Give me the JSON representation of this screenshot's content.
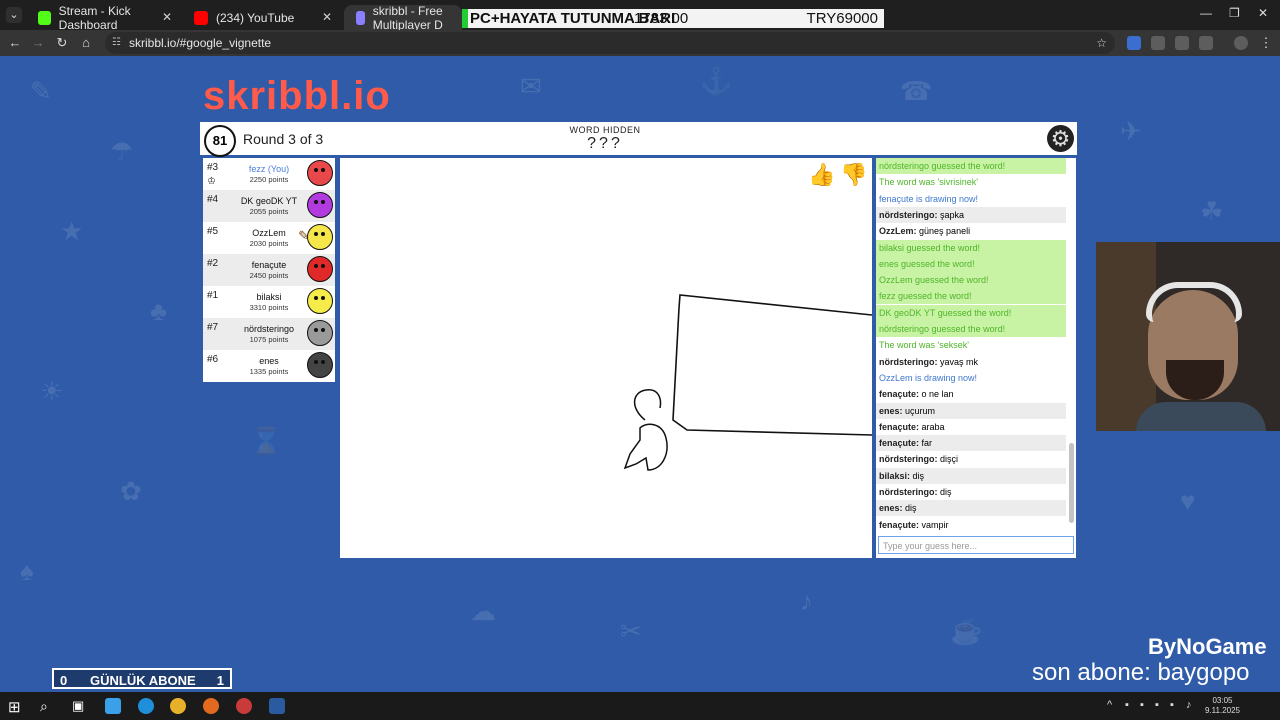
{
  "browser": {
    "tabs": [
      {
        "title": "Stream - Kick Dashboard",
        "icon": "kick-icon",
        "color": "#53fc18"
      },
      {
        "title": "(234) YouTube",
        "icon": "youtube-icon",
        "color": "#ff0000"
      },
      {
        "title": "skribbl - Free Multiplayer D",
        "icon": "skribbl-icon",
        "color": "#8a7fff"
      }
    ],
    "url": "skribbl.io/#google_vignette"
  },
  "ticker": {
    "left": "PC+HAYATA TUTUNMA BARI",
    "middle": "1783.00",
    "right": "TRY69000"
  },
  "game": {
    "logo_text": "skribbl.io",
    "timer": "81",
    "round": "Round 3 of 3",
    "word_status": "WORD HIDDEN",
    "word_mask": "???",
    "hint_tooltip": "vampir"
  },
  "players": [
    {
      "rank": "#3",
      "name": "fezz (You)",
      "points": "2250 points",
      "avatar_color": "#e8484a",
      "you": true,
      "crown": true
    },
    {
      "rank": "#4",
      "name": "DK geoDK YT",
      "points": "2055 points",
      "avatar_color": "#b23be0"
    },
    {
      "rank": "#5",
      "name": "OzzLem",
      "points": "2030 points",
      "avatar_color": "#f5e64a",
      "drawing": true
    },
    {
      "rank": "#2",
      "name": "fenaçute",
      "points": "2450 points",
      "avatar_color": "#e02929"
    },
    {
      "rank": "#1",
      "name": "bilaksi",
      "points": "3310 points",
      "avatar_color": "#f5ec4a"
    },
    {
      "rank": "#7",
      "name": "nördsteringo",
      "points": "1075 points",
      "avatar_color": "#9a9a9a"
    },
    {
      "rank": "#6",
      "name": "enes",
      "points": "1335 points",
      "avatar_color": "#444444"
    }
  ],
  "chat": [
    {
      "type": "ok",
      "text": "nördsteringo guessed the word!"
    },
    {
      "type": "sys",
      "text": "The word was 'sivrisinek'"
    },
    {
      "type": "draw",
      "text": "fenaçute is drawing now!"
    },
    {
      "type": "msg",
      "user": "nördsteringo:",
      "text": "şapka"
    },
    {
      "type": "msg",
      "user": "OzzLem:",
      "text": "güneş paneli"
    },
    {
      "type": "ok",
      "text": "bilaksi guessed the word!"
    },
    {
      "type": "ok",
      "text": "enes guessed the word!"
    },
    {
      "type": "ok",
      "text": "OzzLem guessed the word!"
    },
    {
      "type": "ok",
      "text": "fezz guessed the word!"
    },
    {
      "type": "ok",
      "text": "DK geoDK YT guessed the word!"
    },
    {
      "type": "ok",
      "text": "nördsteringo guessed the word!"
    },
    {
      "type": "sys",
      "text": "The word was 'seksek'"
    },
    {
      "type": "msg",
      "user": "nördsteringo:",
      "text": "yavaş mk"
    },
    {
      "type": "draw",
      "text": "OzzLem is drawing now!"
    },
    {
      "type": "msg",
      "user": "fenaçute:",
      "text": "o ne lan"
    },
    {
      "type": "msg",
      "user": "enes:",
      "text": "uçurum"
    },
    {
      "type": "msg",
      "user": "fenaçute:",
      "text": "araba"
    },
    {
      "type": "msg",
      "user": "fenaçute:",
      "text": "far"
    },
    {
      "type": "msg",
      "user": "nördsteringo:",
      "text": "dişçi"
    },
    {
      "type": "msg",
      "user": "bilaksi:",
      "text": "diş"
    },
    {
      "type": "msg",
      "user": "nördsteringo:",
      "text": "diş"
    },
    {
      "type": "msg",
      "user": "enes:",
      "text": "diş"
    },
    {
      "type": "msg",
      "user": "fenaçute:",
      "text": "vampir"
    }
  ],
  "guess_placeholder": "Type your guess here...",
  "overlay": {
    "sub_left": "0",
    "sub_label": "GÜNLÜK ABONE",
    "sub_right": "1",
    "brand": "ByNoGame",
    "last_sub": "son abone: baygopo"
  },
  "taskbar": {
    "time": "03:05",
    "date": "9.11.2025"
  }
}
